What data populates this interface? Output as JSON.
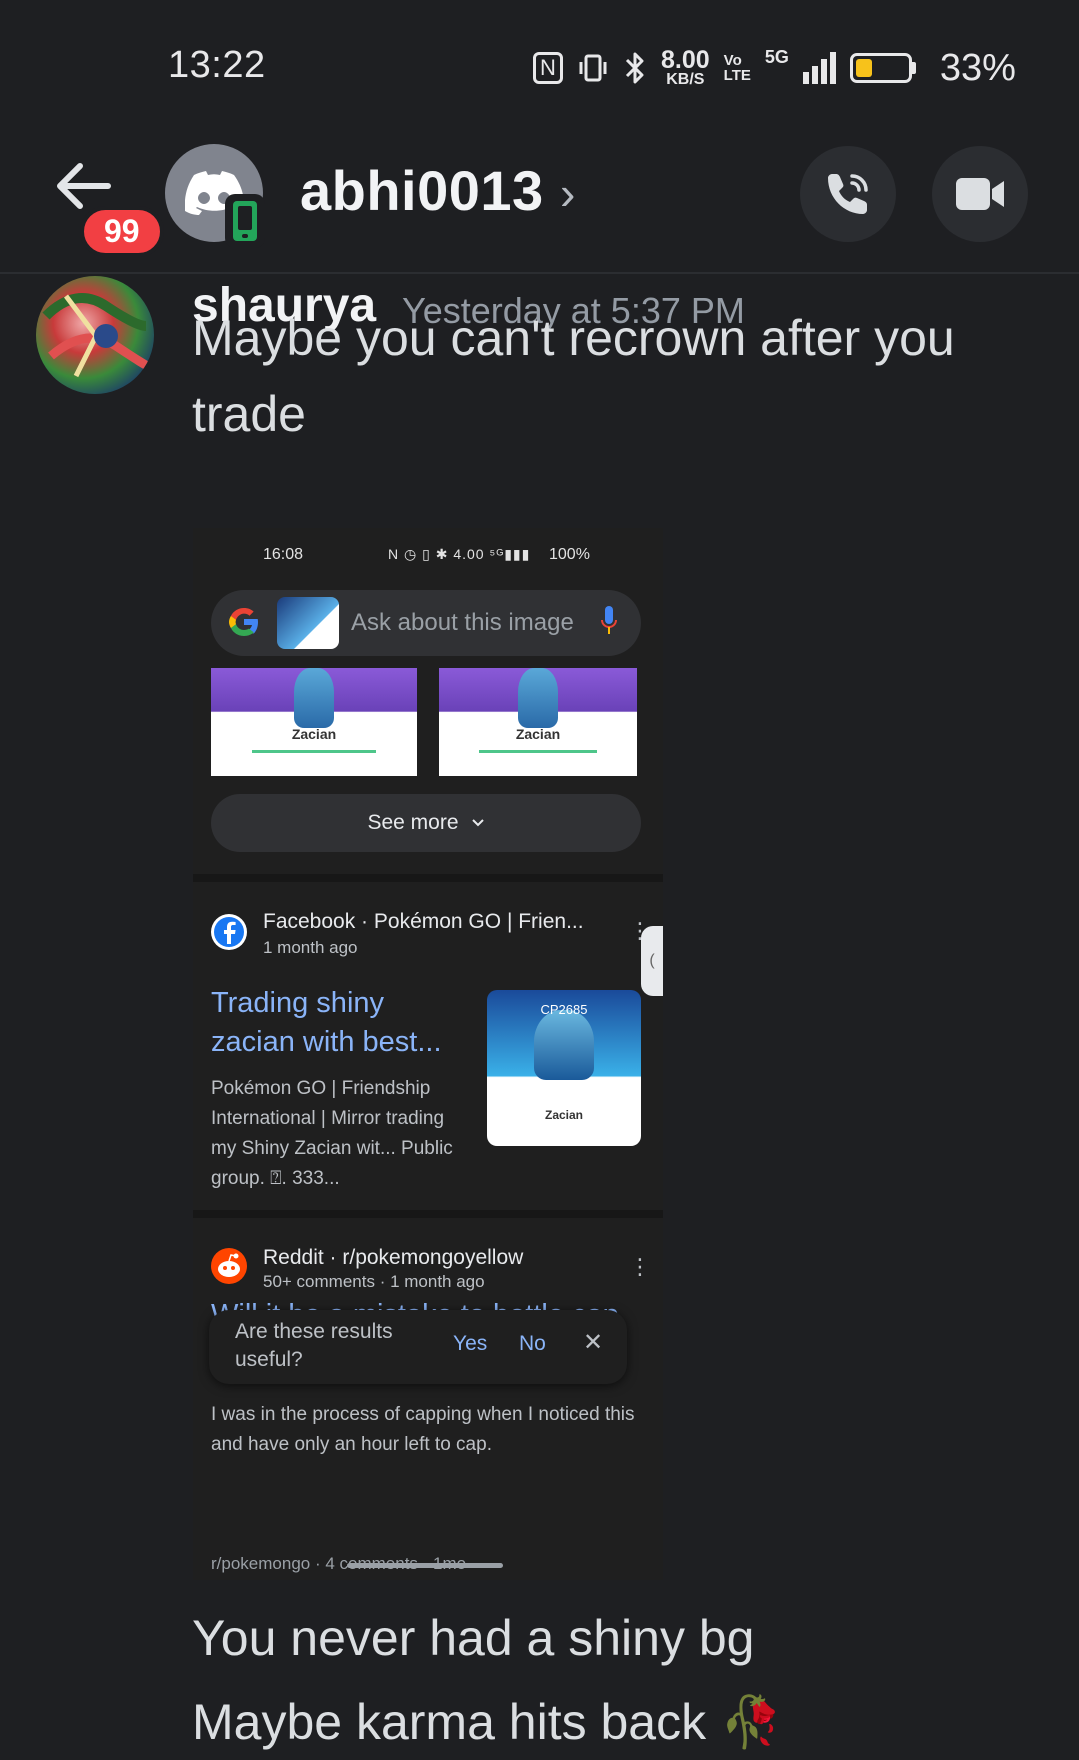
{
  "status_bar": {
    "time": "13:22",
    "nfc": "N",
    "network_speed_value": "8.00",
    "network_speed_unit": "KB/S",
    "volte_top": "Vo",
    "volte_bottom": "LTE",
    "network_type": "5G",
    "battery_percent": "33%",
    "battery_level": 0.33
  },
  "header": {
    "unread_badge": "99",
    "dm_name": "abhi0013",
    "chevron": "›"
  },
  "message": {
    "author": "shaurya",
    "timestamp": "Yesterday at 5:37 PM",
    "lines": [
      "Maybe you can't recrown after you trade",
      "You never had a shiny bg",
      "Maybe karma hits back 🥀"
    ]
  },
  "screenshot": {
    "status_time": "16:08",
    "status_icons": "N ◷ ▯ ✱ 4.00 ⁵ᴳ▮▮▮",
    "status_battery": "100%",
    "search_placeholder": "Ask about this image",
    "image_labels": [
      "Zacian",
      "Zacian"
    ],
    "see_more": "See more",
    "results": [
      {
        "source": "Facebook · Pokémon GO | Frien...",
        "age": "1 month ago",
        "title": "Trading shiny zacian with best...",
        "snippet": "Pokémon GO | Friendship International | Mirror trading my Shiny Zacian wit... Public group. ⍰. 333...",
        "thumb_cp": "CP2685",
        "thumb_name": "Zacian"
      },
      {
        "source": "Reddit · r/pokemongoyellow",
        "age": "50+ comments · 1 month ago",
        "title": "Will it be a mistake to bottle cap my shiny Zacian if I have such...",
        "snippet": "I was in the process of capping when I noticed this and have only an hour left to cap."
      }
    ],
    "feedback": {
      "question": "Are these results useful?",
      "yes": "Yes",
      "no": "No",
      "close": "✕"
    },
    "footer": "r/pokemongo · 4 comments · 1mo"
  },
  "colors": {
    "background": "#1e1f22",
    "badge": "#f23f43",
    "online_mobile": "#23a55a",
    "link_blue": "#8ab4f8"
  }
}
